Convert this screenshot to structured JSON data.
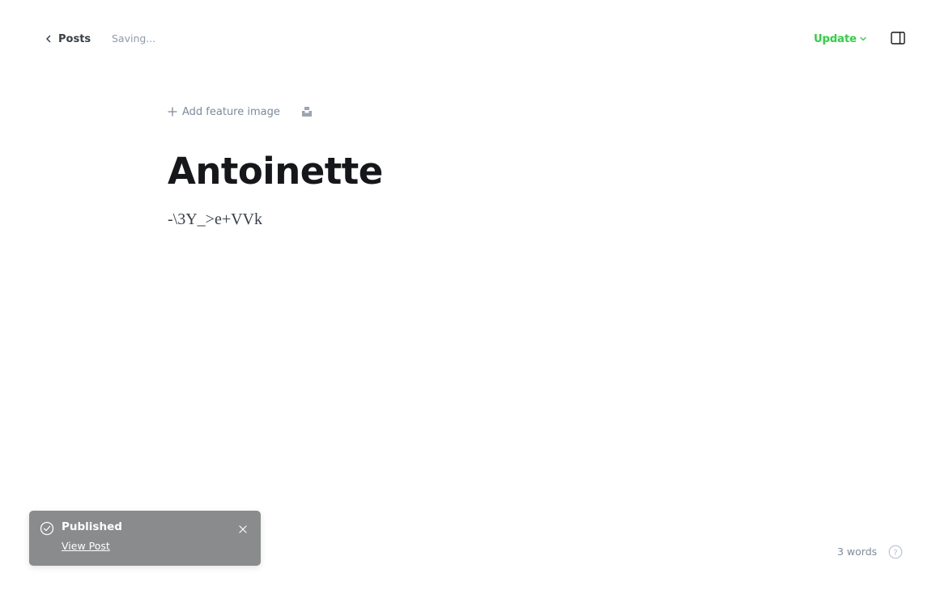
{
  "header": {
    "back_label": "Posts",
    "status": "Saving...",
    "update_label": "Update"
  },
  "editor": {
    "add_feature_label": "Add feature image",
    "title": "Antoinette",
    "body": "-\\3Y_>e+VVk"
  },
  "toast": {
    "title": "Published",
    "link": "View Post"
  },
  "footer": {
    "word_count": "3 words"
  },
  "colors": {
    "accent_green": "#30cf43",
    "toast_bg": "#8a8b8c",
    "muted_text": "#8e9cac"
  },
  "icons": [
    "chevron-left-icon",
    "chevron-down-icon",
    "sidebar-toggle-icon",
    "plus-icon",
    "unsplash-icon",
    "check-circle-icon",
    "close-icon",
    "help-icon"
  ]
}
